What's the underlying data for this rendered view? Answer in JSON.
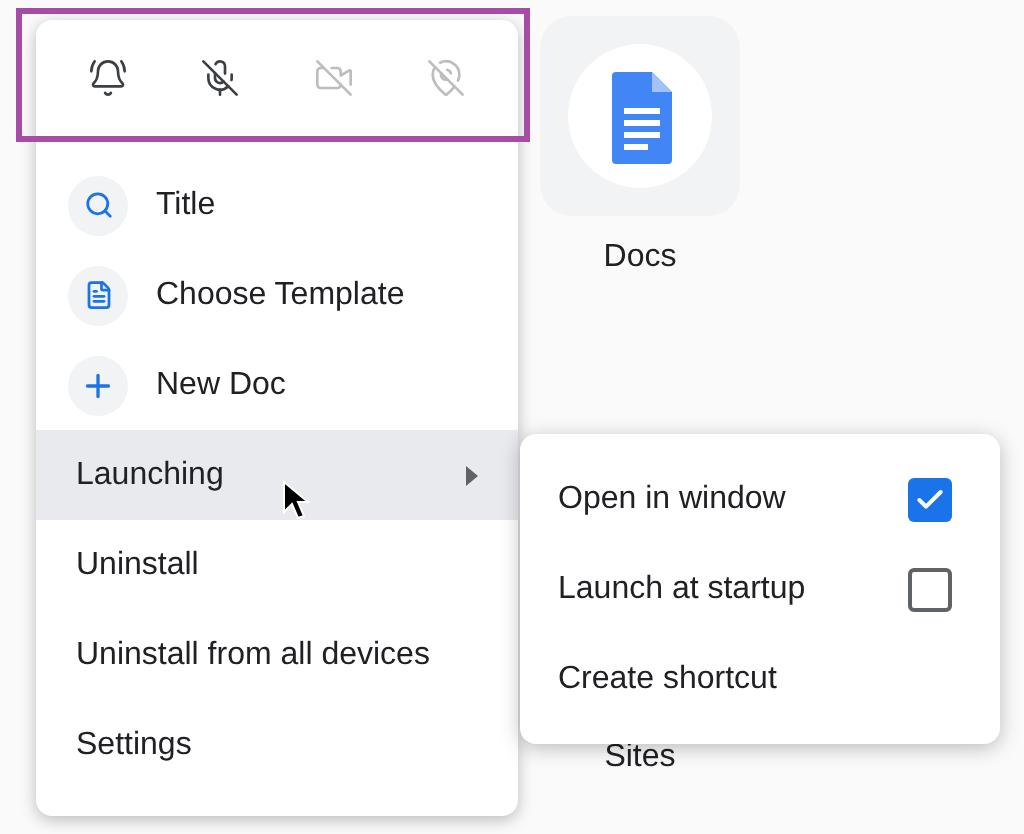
{
  "apps": [
    {
      "label": "Docs",
      "kind": "docs"
    },
    {
      "label": "Sites",
      "kind": "none"
    }
  ],
  "toolbar": [
    {
      "kind": "bell",
      "disabled": false
    },
    {
      "kind": "mic-off",
      "disabled": false
    },
    {
      "kind": "camera-off",
      "disabled": true
    },
    {
      "kind": "location-off",
      "disabled": true
    }
  ],
  "toolbar_highlighted": true,
  "menu": [
    {
      "label": "Title",
      "kind": "search"
    },
    {
      "label": "Choose Template",
      "kind": "template"
    },
    {
      "label": "New Doc",
      "kind": "add"
    },
    {
      "label": "Launching",
      "kind": "submenu",
      "selected": true
    },
    {
      "label": "Uninstall",
      "kind": "plain"
    },
    {
      "label": "Uninstall from all devices",
      "kind": "plain"
    },
    {
      "label": "Settings",
      "kind": "plain"
    }
  ],
  "submenu": [
    {
      "label": "Open in window",
      "kind": "checkbox",
      "checked": true
    },
    {
      "label": "Launch at startup",
      "kind": "checkbox",
      "checked": false
    },
    {
      "label": "Create shortcut",
      "kind": "plain"
    }
  ]
}
